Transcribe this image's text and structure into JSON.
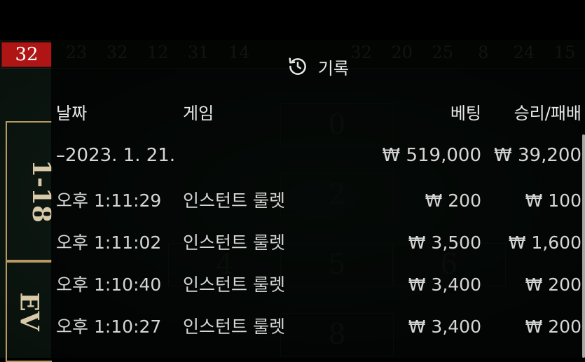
{
  "background_game": {
    "last_result": "32",
    "recent_numbers": [
      "23",
      "32",
      "12",
      "31",
      "14",
      "",
      "",
      "32",
      "20",
      "25",
      "8",
      "24",
      "15"
    ],
    "bet_area_a_label": "1-18",
    "bet_area_b_label": "EV",
    "table_numbers": [
      "0",
      "2",
      "4",
      "5",
      "6",
      "8"
    ]
  },
  "panel": {
    "title": "기록",
    "icon": "history-icon"
  },
  "columns": {
    "date": "날짜",
    "game": "게임",
    "bet": "베팅",
    "win_loss": "승리/패배"
  },
  "date_group": {
    "label": "–2023. 1. 21.",
    "bet_total": "₩ 519,000",
    "win_total": "₩ 39,200"
  },
  "rows": [
    {
      "time": "오후 1:11:29",
      "game": "인스턴트 룰렛",
      "bet": "₩ 200",
      "win": "₩ 100"
    },
    {
      "time": "오후 1:11:02",
      "game": "인스턴트 룰렛",
      "bet": "₩ 3,500",
      "win": "₩ 1,600"
    },
    {
      "time": "오후 1:10:40",
      "game": "인스턴트 룰렛",
      "bet": "₩ 3,400",
      "win": "₩ 200"
    },
    {
      "time": "오후 1:10:27",
      "game": "인스턴트 룰렛",
      "bet": "₩ 3,400",
      "win": "₩ 200"
    }
  ],
  "colors": {
    "last_result_red": "#b01515",
    "panel_bg": "rgba(0,0,0,0.72)",
    "gold_border": "#b79a62"
  }
}
